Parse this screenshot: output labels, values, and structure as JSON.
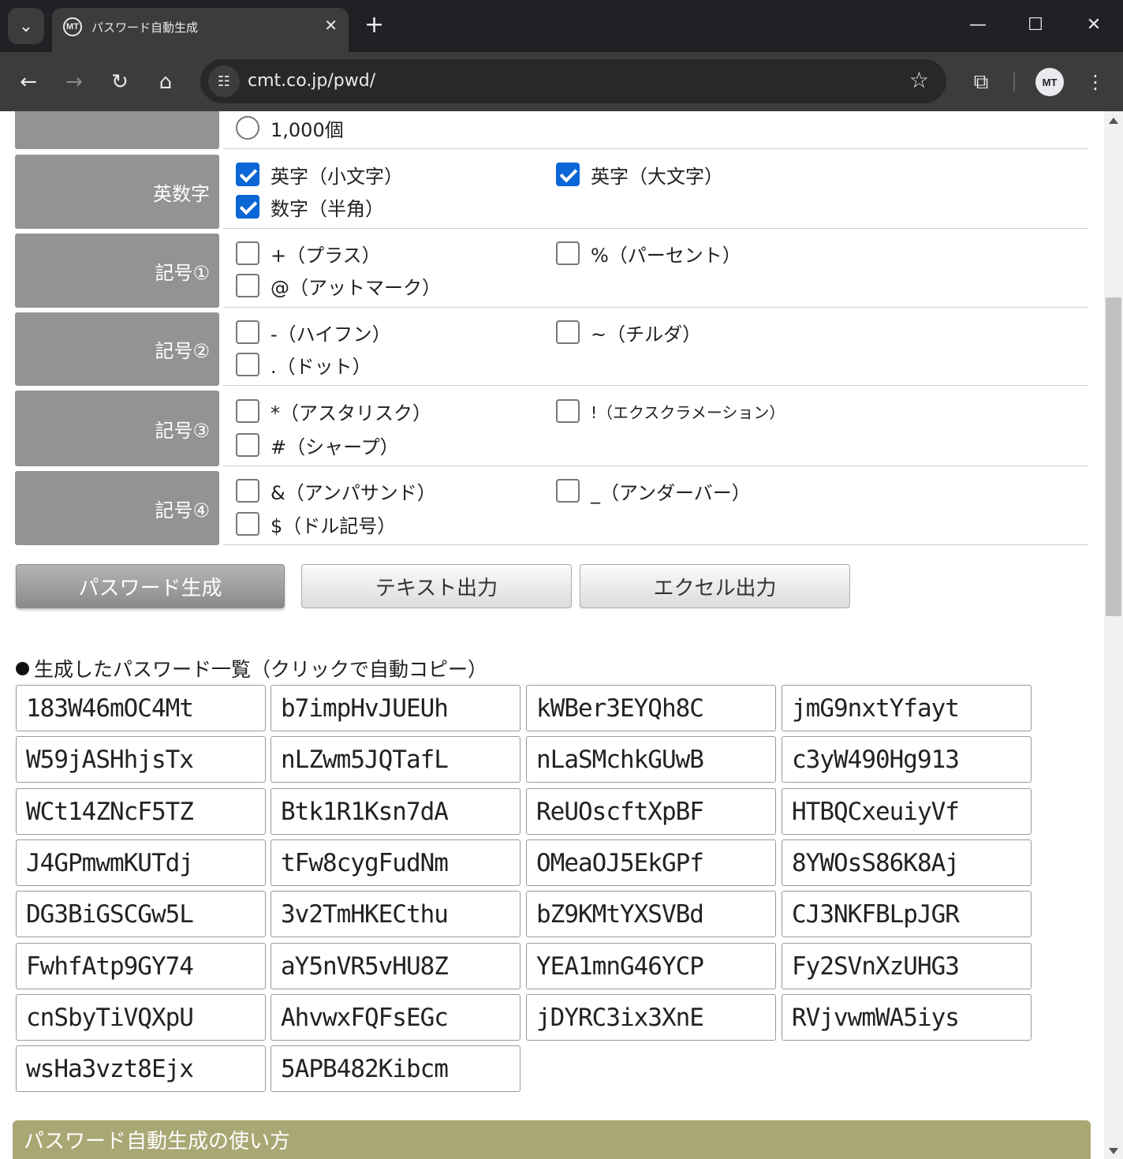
{
  "browser": {
    "tab_title": "パスワード自動生成",
    "url": "cmt.co.jp/pwd/",
    "favicon_text": "MT",
    "profile_text": "MT"
  },
  "options_top": {
    "radio_label": "1,000個"
  },
  "rows": [
    {
      "label": "英数字",
      "options": [
        {
          "text": "英字（小文字）",
          "checked": true
        },
        {
          "text": "英字（大文字）",
          "checked": true
        },
        {
          "text": "数字（半角）",
          "checked": true
        }
      ]
    },
    {
      "label": "記号①",
      "options": [
        {
          "text": "+（プラス）",
          "checked": false
        },
        {
          "text": "%（パーセント）",
          "checked": false
        },
        {
          "text": "@（アットマーク）",
          "checked": false
        }
      ]
    },
    {
      "label": "記号②",
      "options": [
        {
          "text": "-（ハイフン）",
          "checked": false
        },
        {
          "text": "~（チルダ）",
          "checked": false
        },
        {
          "text": ".（ドット）",
          "checked": false
        }
      ]
    },
    {
      "label": "記号③",
      "options": [
        {
          "text": "*（アスタリスク）",
          "checked": false
        },
        {
          "text": "!（エクスクラメーション）",
          "checked": false
        },
        {
          "text": "#（シャープ）",
          "checked": false
        }
      ]
    },
    {
      "label": "記号④",
      "options": [
        {
          "text": "&（アンパサンド）",
          "checked": false
        },
        {
          "text": "_（アンダーバー）",
          "checked": false
        },
        {
          "text": "$（ドル記号）",
          "checked": false
        }
      ]
    }
  ],
  "buttons": {
    "generate": "パスワード生成",
    "text_export": "テキスト出力",
    "excel_export": "エクセル出力"
  },
  "list_heading": "生成したパスワード一覧（クリックで自動コピー）",
  "passwords": [
    "183W46mOC4Mt",
    "b7impHvJUEUh",
    "kWBer3EYQh8C",
    "jmG9nxtYfayt",
    "W59jASHhjsTx",
    "nLZwm5JQTafL",
    "nLaSMchkGUwB",
    "c3yW490Hg913",
    "WCt14ZNcF5TZ",
    "Btk1R1Ksn7dA",
    "ReUOscftXpBF",
    "HTBQCxeuiyVf",
    "J4GPmwmKUTdj",
    "tFw8cygFudNm",
    "OMeaOJ5EkGPf",
    "8YWOsS86K8Aj",
    "DG3BiGSCGw5L",
    "3v2TmHKECthu",
    "bZ9KMtYXSVBd",
    "CJ3NKFBLpJGR",
    "FwhfAtp9GY74",
    "aY5nVR5vHU8Z",
    "YEA1mnG46YCP",
    "Fy2SVnXzUHG3",
    "cnSbyTiVQXpU",
    "AhvwxFQFsEGc",
    "jDYRC3ix3XnE",
    "RVjvwmWA5iys",
    "wsHa3vzt8Ejx",
    "5APB482Kibcm"
  ],
  "howto_title": "パスワード自動生成の使い方",
  "colors": {
    "label_bg": "#939393",
    "checkbox_checked": "#0b66d6",
    "howto_bg": "#a9a774"
  }
}
